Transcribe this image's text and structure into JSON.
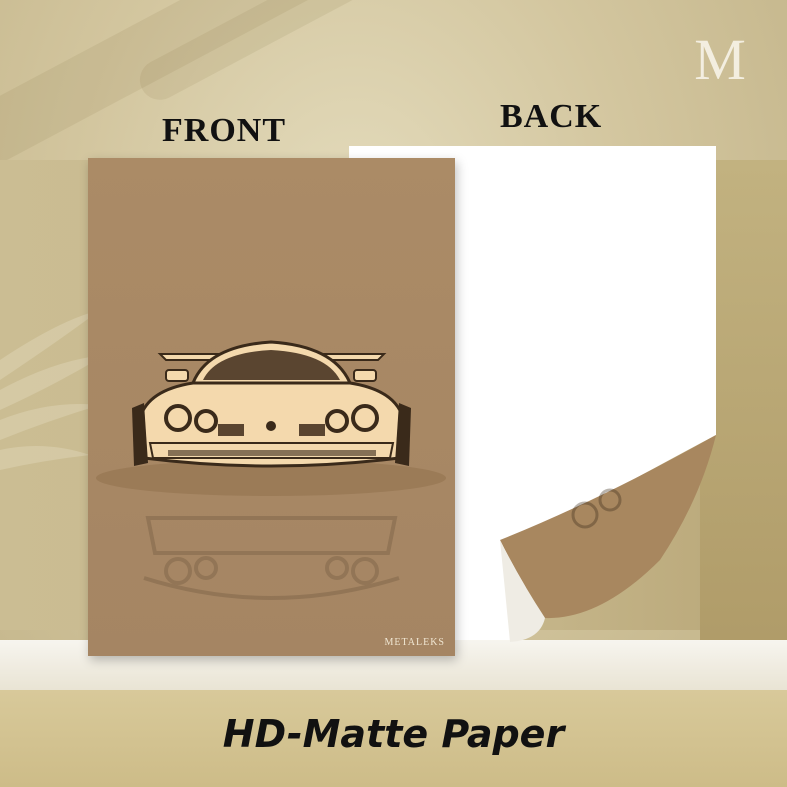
{
  "labels": {
    "front": "FRONT",
    "back": "BACK"
  },
  "logo": {
    "letter": "M"
  },
  "poster": {
    "brand": "METALEKS"
  },
  "title": "HD-Matte Paper",
  "colors": {
    "poster_bg": "#a98963",
    "car_body": "#f4d9ad",
    "car_outline": "#3a2a1a",
    "back_sheet": "#ffffff",
    "backdrop": "#cdbf98"
  },
  "icons": [
    "logo-m-icon",
    "palm-leaf-icon",
    "car-illustration-icon",
    "page-curl-icon"
  ]
}
